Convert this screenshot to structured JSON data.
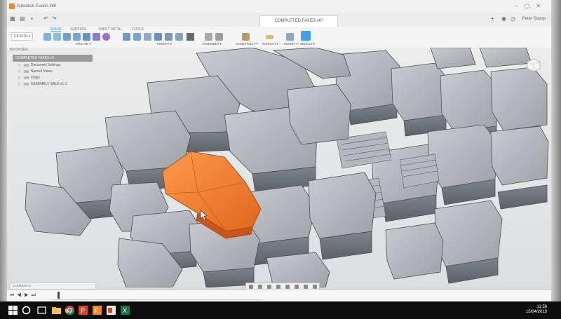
{
  "window": {
    "app_title": "Autodesk Fusion 360",
    "document_tab": "COMPLETED FAXES v6*",
    "user_name": "Peter Stamp"
  },
  "toolbar": {
    "workspace": "DESIGN ▾",
    "tabs": [
      "SOLID",
      "SURFACE",
      "SHEET METAL",
      "TOOLS"
    ],
    "active_tab": "SOLID",
    "groups": {
      "create": "CREATE ▾",
      "modify": "MODIFY ▾",
      "assemble": "ASSEMBLE ▾",
      "construct": "CONSTRUCT ▾",
      "inspect": "INSPECT ▾",
      "insert": "INSERT ▾",
      "select": "SELECT ▾"
    },
    "accent_color": "#3fa0e6"
  },
  "browser": {
    "header": "BROWSER",
    "root": "COMPLETED FAXES v6",
    "items": [
      "Document Settings",
      "Named Views",
      "Origin",
      "ASSEMBLY SALE v1:1"
    ]
  },
  "comments_label": "COMMENTS",
  "model": {
    "highlight_color": "#f07d2c",
    "part_color": "#7c8186"
  },
  "taskbar": {
    "time": "11:56",
    "date": "15/04/2019",
    "apps": [
      "chrome-icon",
      "powerpoint-icon",
      "fusion-icon",
      "word-icon",
      "excel-icon"
    ]
  }
}
